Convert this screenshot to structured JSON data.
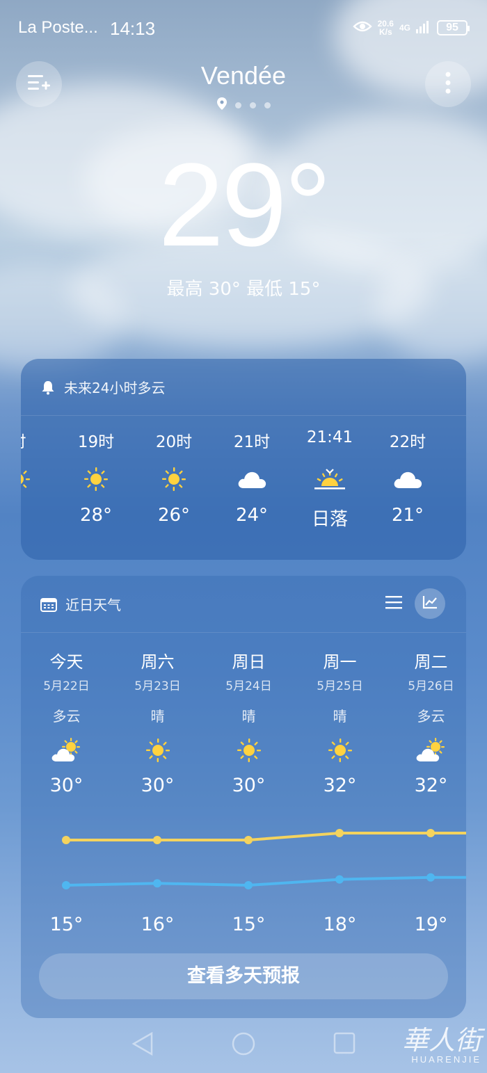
{
  "status_bar": {
    "carrier": "La Poste...",
    "time": "14:13",
    "net_speed_top": "20.6",
    "net_speed_unit": "K/s",
    "network": "4G",
    "battery": "95"
  },
  "header": {
    "location": "Vendée",
    "page_count": 4,
    "active_page": 0
  },
  "current": {
    "temperature": "29°",
    "high_low": "最高 30° 最低 15°"
  },
  "hourly": {
    "alert": "未来24小时多云",
    "items": [
      {
        "time": "时",
        "icon": "sun-icon",
        "temp": "°"
      },
      {
        "time": "19时",
        "icon": "sun-icon",
        "temp": "28°"
      },
      {
        "time": "20时",
        "icon": "sun-icon",
        "temp": "26°"
      },
      {
        "time": "21时",
        "icon": "cloud-icon",
        "temp": "24°"
      },
      {
        "time": "21:41",
        "icon": "sunset-icon",
        "temp": "日落"
      },
      {
        "time": "22时",
        "icon": "cloud-icon",
        "temp": "21°"
      }
    ]
  },
  "daily": {
    "title": "近日天气",
    "days": [
      {
        "name": "今天",
        "date": "5月22日",
        "cond": "多云",
        "icon": "partly-cloudy-icon",
        "high": "30°",
        "low": "15°"
      },
      {
        "name": "周六",
        "date": "5月23日",
        "cond": "晴",
        "icon": "sun-icon",
        "high": "30°",
        "low": "16°"
      },
      {
        "name": "周日",
        "date": "5月24日",
        "cond": "晴",
        "icon": "sun-icon",
        "high": "30°",
        "low": "15°"
      },
      {
        "name": "周一",
        "date": "5月25日",
        "cond": "晴",
        "icon": "sun-icon",
        "high": "32°",
        "low": "18°"
      },
      {
        "name": "周二",
        "date": "5月26日",
        "cond": "多云",
        "icon": "partly-cloudy-icon",
        "high": "32°",
        "low": "19°"
      }
    ],
    "high_values": [
      30,
      30,
      30,
      32,
      32
    ],
    "low_values": [
      15,
      16,
      15,
      18,
      19
    ],
    "high_color": "#f4d35e",
    "low_color": "#4fb6f0",
    "more_button": "查看多天预报"
  },
  "watermark": {
    "cn": "華人街",
    "en": "HUARENJIE"
  }
}
